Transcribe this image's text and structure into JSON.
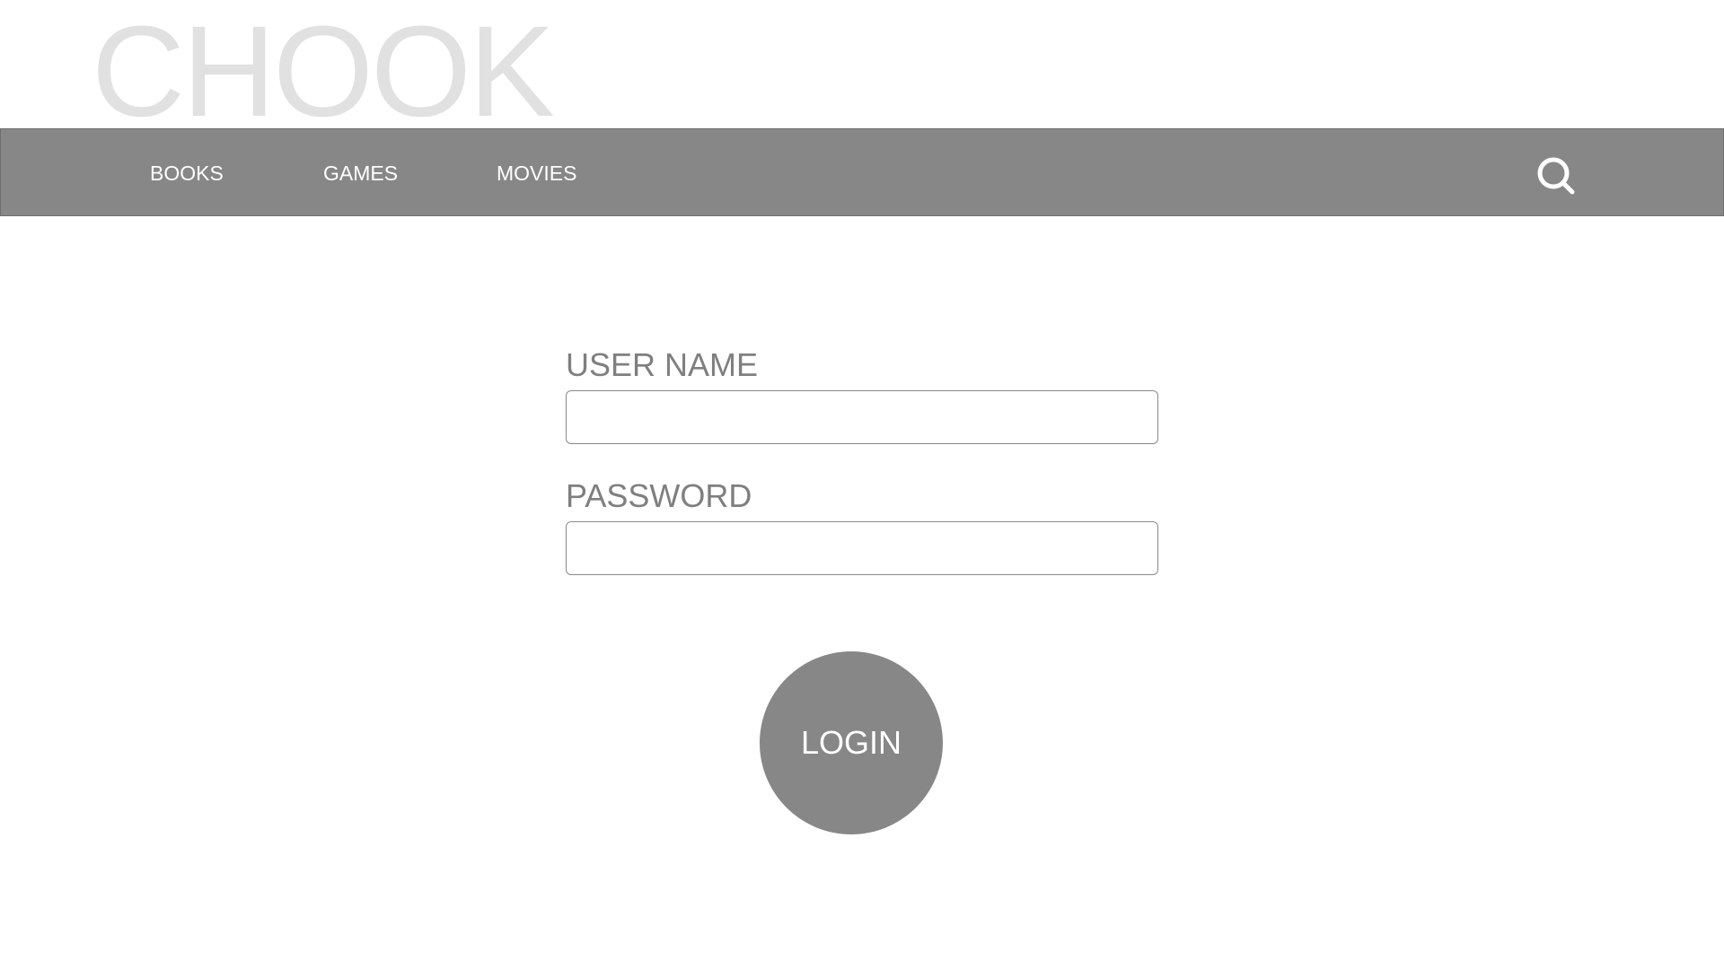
{
  "header": {
    "brand": "CHOOK"
  },
  "nav": {
    "items": [
      {
        "label": "BOOKS"
      },
      {
        "label": "GAMES"
      },
      {
        "label": "MOVIES"
      }
    ],
    "search_icon": "search-icon"
  },
  "form": {
    "username_label": "USER NAME",
    "username_value": "",
    "password_label": "PASSWORD",
    "password_value": "",
    "login_label": "LOGIN"
  },
  "colors": {
    "brand": "#e1e1e1",
    "navbar": "#878787",
    "label": "#7f7f7f",
    "button": "#878787",
    "nav_text": "#ffffff"
  }
}
